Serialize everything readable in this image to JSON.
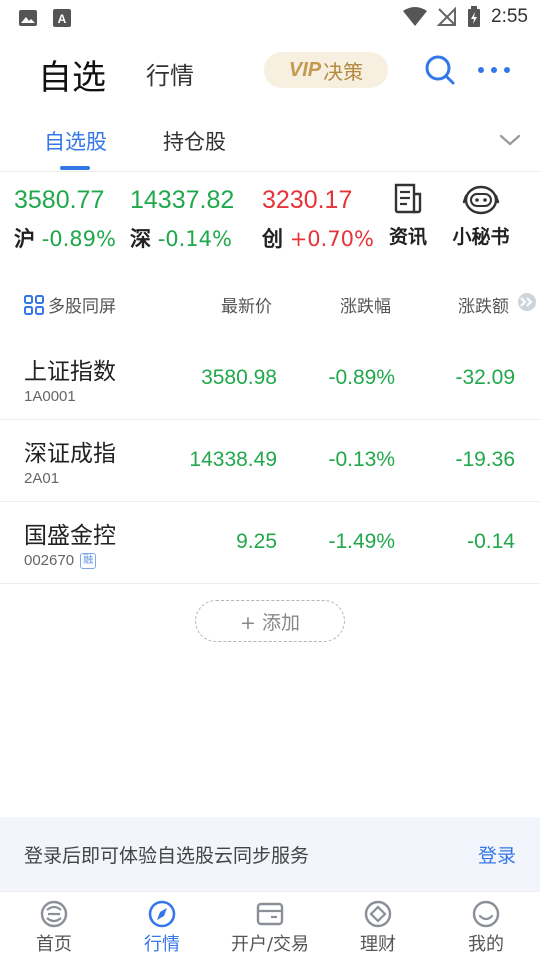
{
  "status_bar": {
    "time": "2:55"
  },
  "header": {
    "tab_watchlist": "自选",
    "tab_market": "行情",
    "vip_label": "VIP",
    "vip_sub": "决策"
  },
  "sub_tabs": [
    {
      "label": "自选股",
      "active": true
    },
    {
      "label": "持仓股",
      "active": false
    }
  ],
  "indices": [
    {
      "value": "3580.77",
      "name": "沪",
      "change": "-0.89%",
      "trend": "down"
    },
    {
      "value": "14337.82",
      "name": "深",
      "change": "-0.14%",
      "trend": "down"
    },
    {
      "value": "3230.17",
      "name": "创",
      "change": "+0.70%",
      "trend": "up"
    }
  ],
  "tools": [
    {
      "label": "资讯",
      "icon": "news-icon"
    },
    {
      "label": "小秘书",
      "icon": "robot-icon"
    }
  ],
  "table_header": {
    "multi_screen": "多股同屏",
    "latest_price": "最新价",
    "change_pct": "涨跌幅",
    "change_amt": "涨跌额"
  },
  "stocks": [
    {
      "name": "上证指数",
      "code": "1A0001",
      "price": "3580.98",
      "pct": "-0.89%",
      "amt": "-32.09",
      "margin_tag": ""
    },
    {
      "name": "深证成指",
      "code": "2A01",
      "price": "14338.49",
      "pct": "-0.13%",
      "amt": "-19.36",
      "margin_tag": ""
    },
    {
      "name": "国盛金控",
      "code": "002670",
      "price": "9.25",
      "pct": "-1.49%",
      "amt": "-0.14",
      "margin_tag": "融"
    }
  ],
  "add_button": "+ 添加",
  "login_banner": {
    "text": "登录后即可体验自选股云同步服务",
    "link": "登录"
  },
  "bottom_nav": [
    {
      "label": "首页",
      "icon": "home-logo-icon",
      "active": false
    },
    {
      "label": "行情",
      "icon": "compass-icon",
      "active": true
    },
    {
      "label": "开户/交易",
      "icon": "card-icon",
      "active": false
    },
    {
      "label": "理财",
      "icon": "diamond-icon",
      "active": false
    },
    {
      "label": "我的",
      "icon": "smiley-icon",
      "active": false
    }
  ],
  "colors": {
    "accent": "#3477e8",
    "down": "#20a84b",
    "up": "#e5343a",
    "vip_gold": "#c49a4e"
  }
}
